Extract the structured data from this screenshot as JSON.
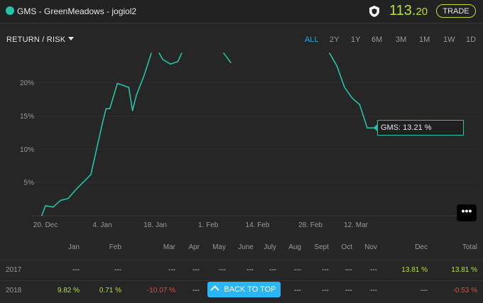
{
  "header": {
    "title": "GMS - GreenMeadows - jogiol2",
    "price_int": "113.",
    "price_dec": "20",
    "trade_label": "TRADE",
    "colors": {
      "accent": "#25c3a9",
      "price": "#b5e33a"
    }
  },
  "controls": {
    "return_risk_label": "RETURN / RISK",
    "ranges": [
      "ALL",
      "2Y",
      "1Y",
      "6M",
      "3M",
      "1M",
      "1W",
      "1D"
    ],
    "active_range": "ALL"
  },
  "chart_data": {
    "type": "line",
    "y_tick_labels": [
      "20%",
      "15%",
      "10%",
      "5%"
    ],
    "x_tick_labels": [
      "20. Dec",
      "4. Jan",
      "18. Jan",
      "1. Feb",
      "14. Feb",
      "28. Feb",
      "12. Mar"
    ],
    "tooltip": "GMS: 13.21 %",
    "series": [
      {
        "values": [
          [
            "2017-12-19",
            0.0
          ],
          [
            "2017-12-20",
            1.5
          ],
          [
            "2017-12-22",
            1.3
          ],
          [
            "2017-12-24",
            2.3
          ],
          [
            "2017-12-26",
            2.6
          ],
          [
            "2017-12-28",
            3.9
          ],
          [
            "2018-01-01",
            6.2
          ],
          [
            "2018-01-04",
            13.8
          ],
          [
            "2018-01-05",
            16.1
          ],
          [
            "2018-01-06",
            16.1
          ],
          [
            "2018-01-08",
            19.9
          ],
          [
            "2018-01-11",
            19.3
          ],
          [
            "2018-01-12",
            15.8
          ],
          [
            "2018-01-13",
            18.1
          ],
          [
            "2018-01-15",
            21.0
          ],
          [
            "2018-01-17",
            24.5
          ],
          [
            "2018-01-17",
            24.5
          ]
        ]
      },
      {
        "values": [
          [
            "2018-01-19",
            24.5
          ],
          [
            "2018-01-20",
            23.5
          ],
          [
            "2018-01-22",
            22.8
          ],
          [
            "2018-01-24",
            23.2
          ],
          [
            "2018-01-25",
            24.5
          ]
        ]
      },
      {
        "values": [
          [
            "2018-02-05",
            24.5
          ],
          [
            "2018-02-07",
            23.0
          ]
        ]
      },
      {
        "values": [
          [
            "2018-03-05",
            24.5
          ],
          [
            "2018-03-07",
            22.5
          ],
          [
            "2018-03-09",
            19.3
          ],
          [
            "2018-03-11",
            17.7
          ],
          [
            "2018-03-13",
            16.7
          ],
          [
            "2018-03-15",
            13.2
          ],
          [
            "2018-03-17",
            13.21
          ]
        ]
      }
    ],
    "ylim": [
      0,
      24.5
    ],
    "grid": true,
    "line_color": "#25c3a9"
  },
  "table": {
    "columns": [
      "Jan",
      "Feb",
      "Mar",
      "Apr",
      "May",
      "June",
      "July",
      "Aug",
      "Sept",
      "Oct",
      "Nov",
      "Dec",
      "Total"
    ],
    "rows": [
      {
        "year": "2017",
        "cells": [
          "---",
          "---",
          "---",
          "---",
          "---",
          "---",
          "---",
          "---",
          "---",
          "---",
          "---",
          "13.81 %",
          "13.81 %"
        ],
        "signs": [
          "",
          "",
          "",
          "",
          "",
          "",
          "",
          "",
          "",
          "",
          "",
          "pos",
          "pos"
        ]
      },
      {
        "year": "2018",
        "cells": [
          "9.82 %",
          "0.71 %",
          "-10.07 %",
          "---",
          "",
          "",
          "",
          "---",
          "---",
          "---",
          "---",
          "---",
          "-0.53 %"
        ],
        "signs": [
          "pos",
          "pos",
          "neg",
          "",
          "",
          "",
          "",
          "",
          "",
          "",
          "",
          "",
          "neg"
        ]
      }
    ]
  },
  "back_to_top_label": "BACK TO TOP",
  "more_menu_label": "•••"
}
